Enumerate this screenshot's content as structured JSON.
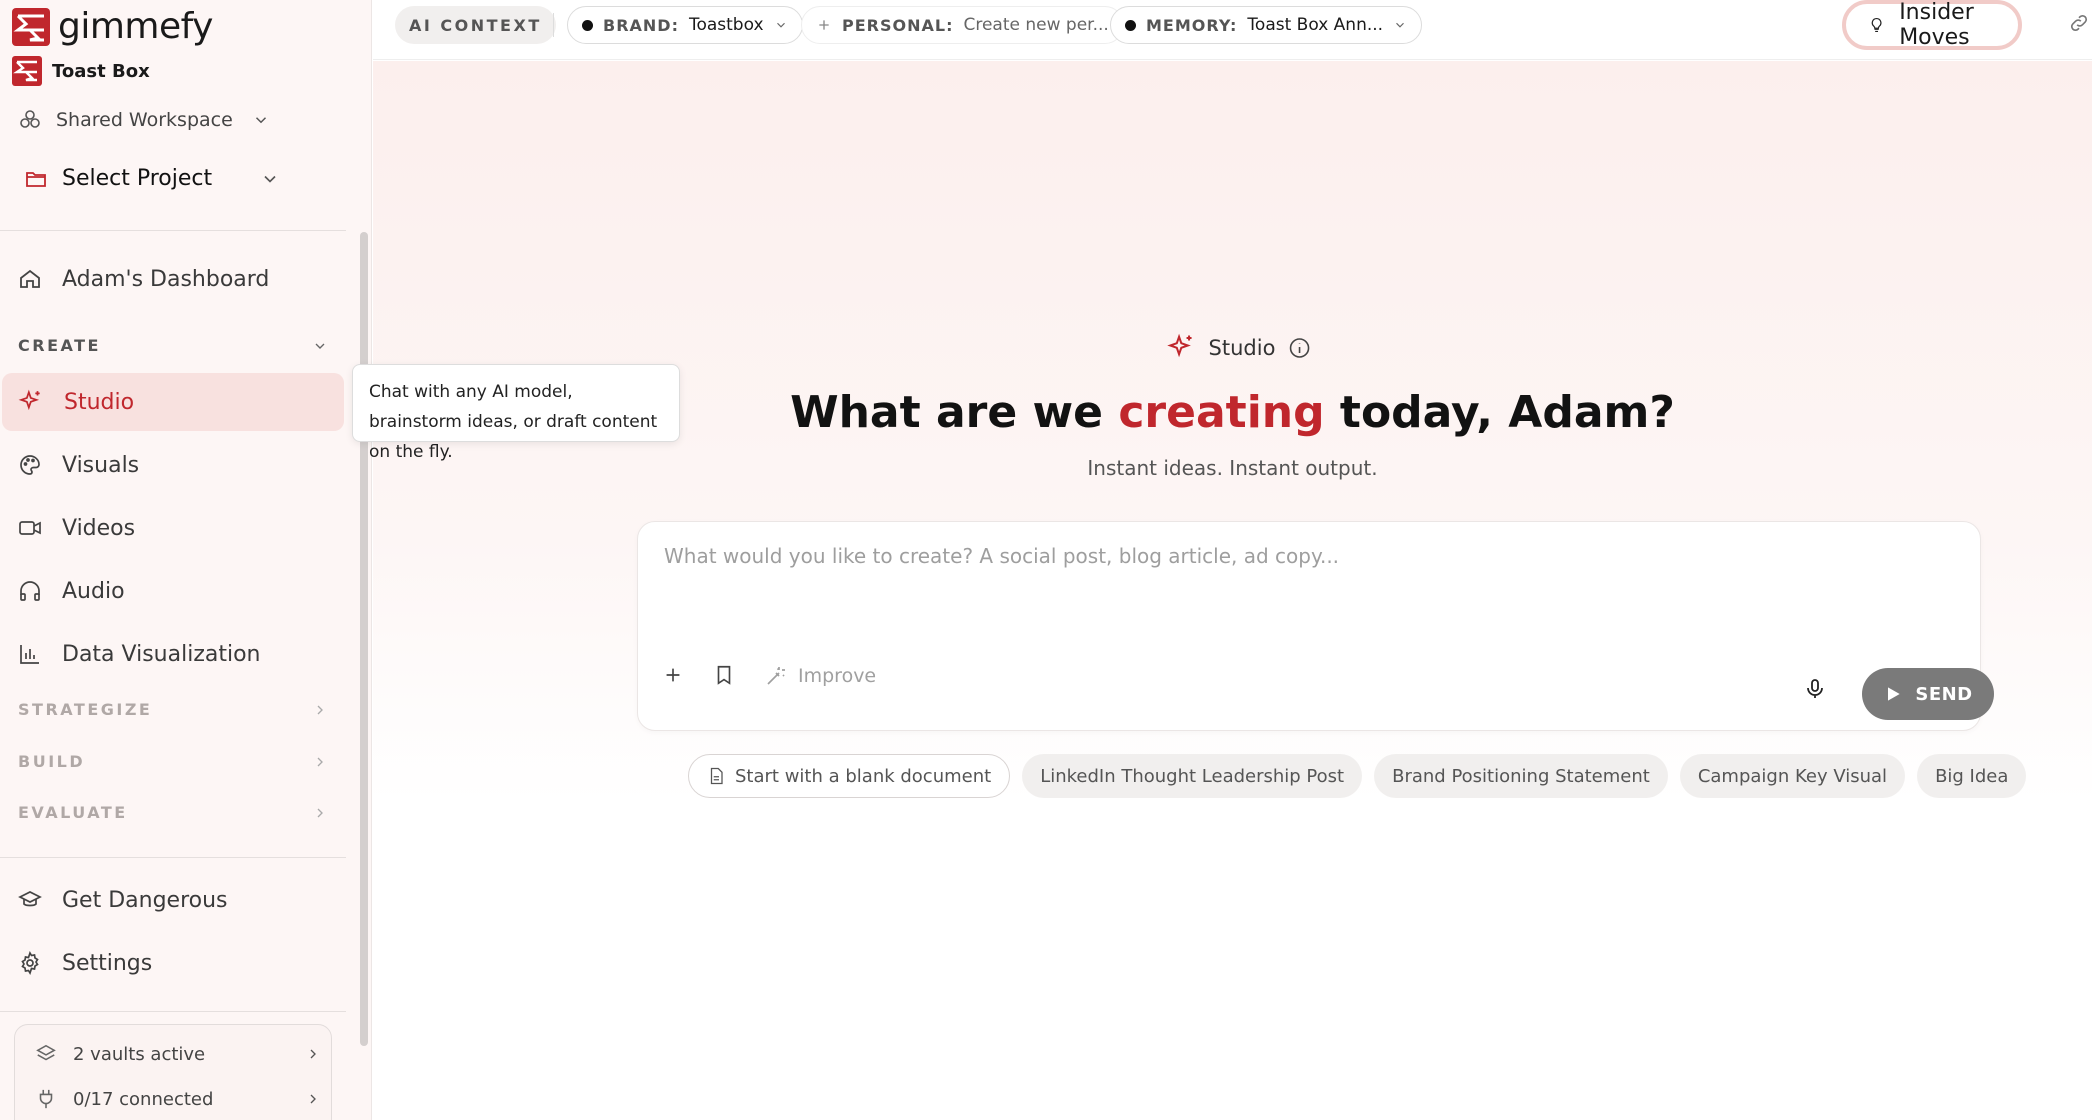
{
  "app": {
    "logo_text": "gimmefy",
    "brand_name": "Toast Box"
  },
  "sidebar": {
    "workspace_label": "Shared Workspace",
    "project_label": "Select Project",
    "dashboard_label": "Adam's Dashboard",
    "create_section": "CREATE",
    "create_items": [
      {
        "label": "Studio",
        "icon": "sparkle-icon",
        "active": true
      },
      {
        "label": "Visuals",
        "icon": "palette-icon"
      },
      {
        "label": "Videos",
        "icon": "video-camera-icon"
      },
      {
        "label": "Audio",
        "icon": "headphones-icon"
      },
      {
        "label": "Data Visualization",
        "icon": "bar-chart-icon"
      }
    ],
    "sections": [
      "STRATEGIZE",
      "BUILD",
      "EVALUATE"
    ],
    "bottom_items": [
      {
        "label": "Get Dangerous",
        "icon": "graduation-cap-icon"
      },
      {
        "label": "Settings",
        "icon": "gear-icon"
      }
    ],
    "vaults_label": "2 vaults active",
    "connected_label": "0/17 connected"
  },
  "topbar": {
    "ai_context": "AI CONTEXT",
    "brand_key": "BRAND:",
    "brand_value": "Toastbox",
    "personal_key": "PERSONAL:",
    "personal_value": "Create new per...",
    "memory_key": "MEMORY:",
    "memory_value": "Toast Box Ann...",
    "insider_label": "Insider Moves"
  },
  "tooltip": {
    "text": "Chat with any AI model, brainstorm ideas, or draft content on the fly."
  },
  "main": {
    "studio_label": "Studio",
    "headline_pre": "What are we ",
    "headline_accent": "creating",
    "headline_post": " today, Adam?",
    "subline": "Instant ideas. Instant output.",
    "composer_placeholder": "What would you like to create? A social post, blog article, ad copy...",
    "improve_label": "Improve",
    "send_label": "SEND",
    "chips": [
      "Start with a blank document",
      "LinkedIn Thought Leadership Post",
      "Brand Positioning Statement",
      "Campaign Key Visual",
      "Big Idea"
    ]
  },
  "colors": {
    "accent": "#c0272d",
    "active_bg": "#f8e1df",
    "send_bg": "#7a7a7a",
    "highlight_border": "#f1cbc8"
  }
}
